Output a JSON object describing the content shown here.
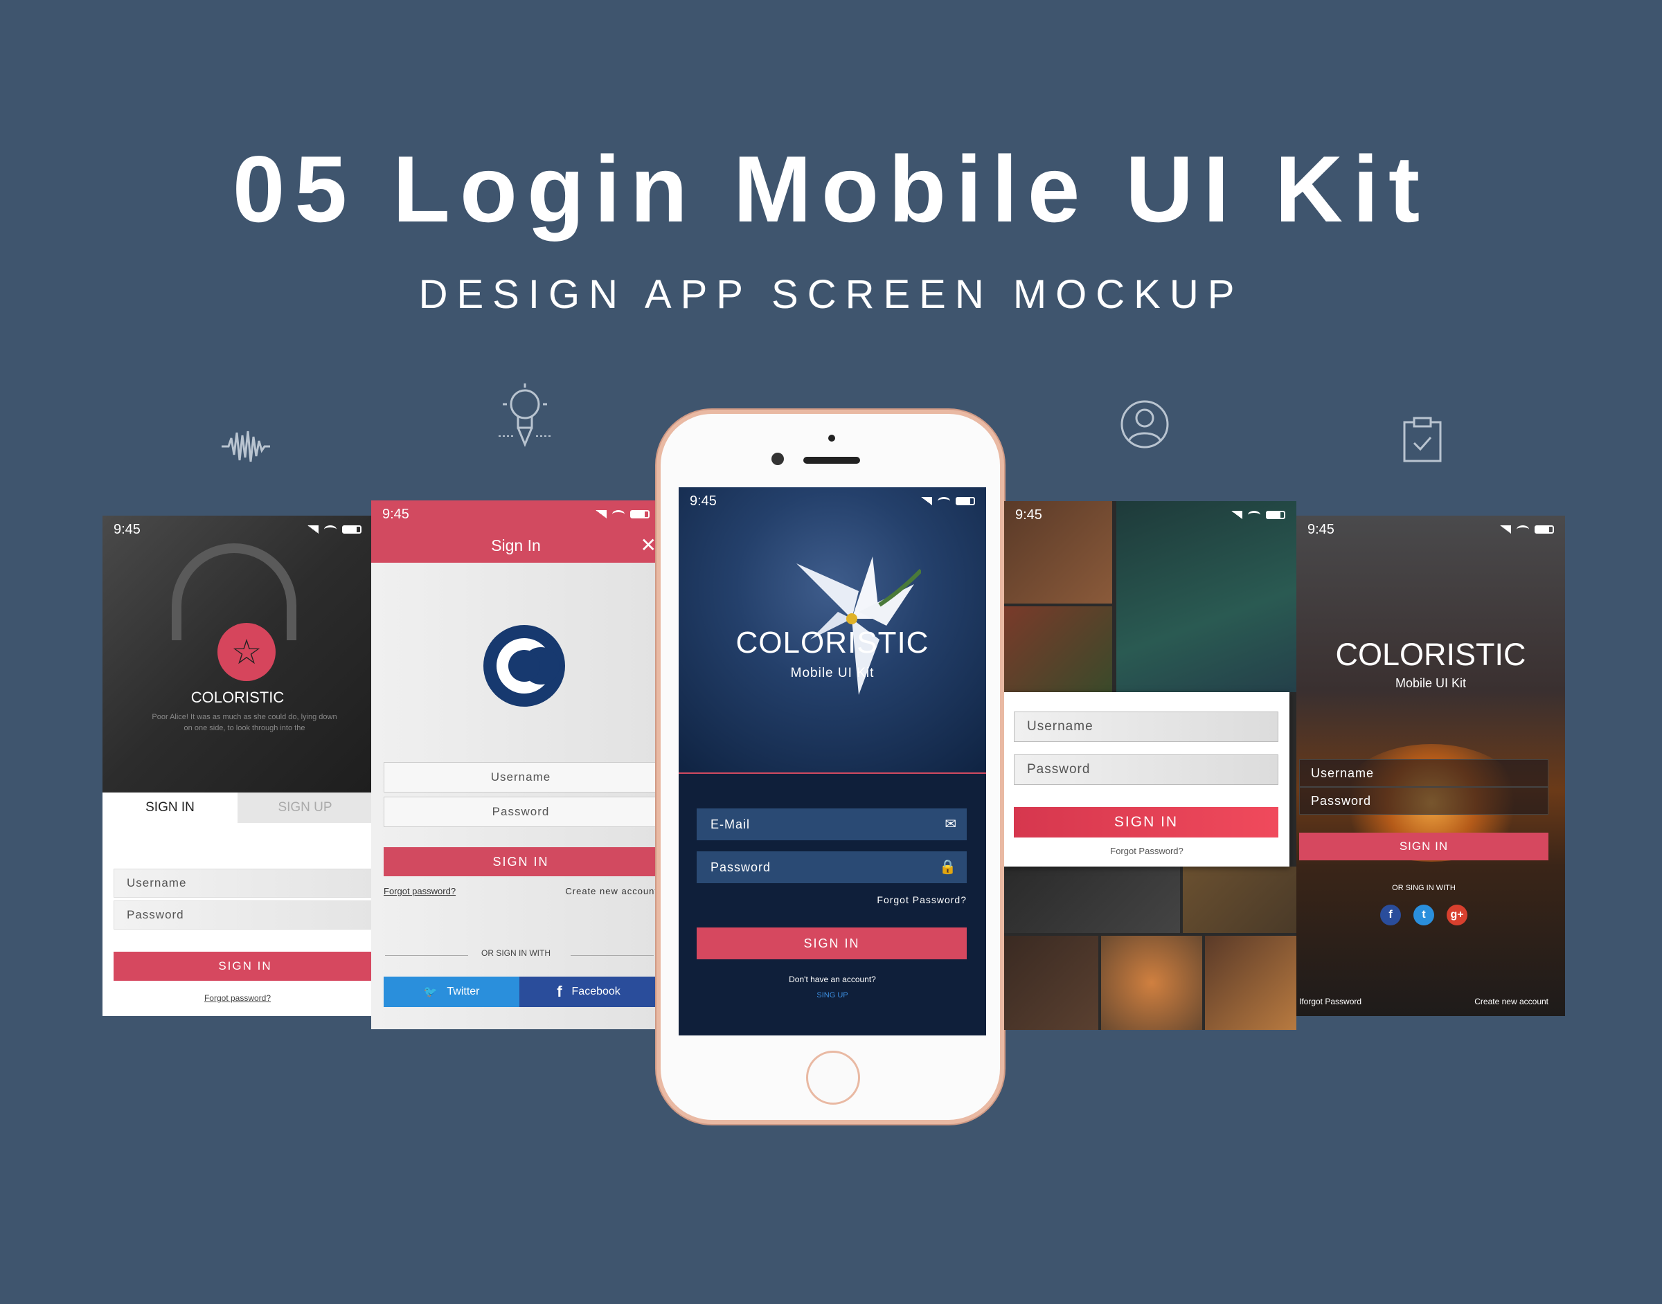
{
  "title": "05 Login Mobile UI Kit",
  "subtitle": "DESIGN APP SCREEN MOCKUP",
  "icons": [
    "soundwave-icon",
    "lightbulb-icon",
    "user-icon",
    "clipboard-icon"
  ],
  "colors": {
    "background": "#3f556e",
    "accent": "#d6485f",
    "phone_rose_gold": "#e9b9a3",
    "twitter": "#2a8fdc",
    "facebook": "#2a4d9b"
  },
  "screen1": {
    "time": "9:45",
    "brand": "COLORISTIC",
    "blurb": "Poor Alice! It was as much as she could do, lying down on one side, to look through into the",
    "tab_signin": "SIGN IN",
    "tab_signup": "SIGN UP",
    "username_placeholder": "Username",
    "password_placeholder": "Password",
    "signin_button": "SIGN IN",
    "forgot": "Forgot password?"
  },
  "screen2": {
    "time": "9:45",
    "header_title": "Sign In",
    "username_placeholder": "Username",
    "password_placeholder": "Password",
    "signin_button": "SIGN IN",
    "forgot": "Forgot password?",
    "create": "Create new account",
    "or_signin": "OR SIGN IN WITH",
    "twitter": "Twitter",
    "facebook": "Facebook"
  },
  "screen3": {
    "time": "9:45",
    "brand": "COLORISTIC",
    "sub": "Mobile UI Kit",
    "email_placeholder": "E-Mail",
    "password_placeholder": "Password",
    "forgot": "Forgot Password?",
    "signin_button": "SIGN IN",
    "noacct": "Don't have an account?",
    "signup": "SING UP"
  },
  "screen4": {
    "time": "9:45",
    "username_placeholder": "Username",
    "password_placeholder": "Password",
    "signin_button": "SIGN IN",
    "forgot": "Forgot Password?"
  },
  "screen5": {
    "time": "9:45",
    "brand": "COLORISTIC",
    "sub": "Mobile UI Kit",
    "username_placeholder": "Username",
    "password_placeholder": "Password",
    "signin_button": "SIGN IN",
    "or_signin": "OR SING IN WITH",
    "forgot": "Iforgot Password",
    "create": "Create new account"
  }
}
